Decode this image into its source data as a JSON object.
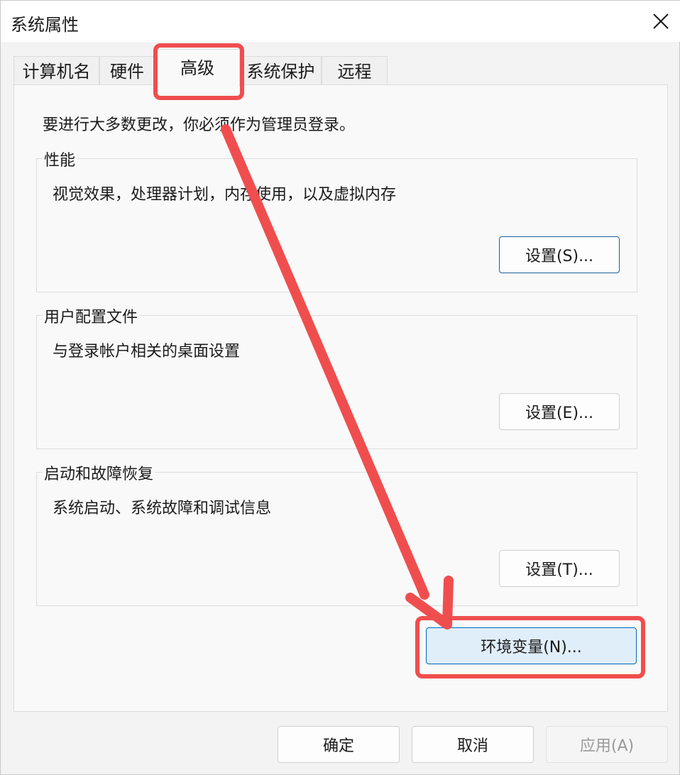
{
  "window": {
    "title": "系统属性"
  },
  "tabs": [
    {
      "label": "计算机名"
    },
    {
      "label": "硬件"
    },
    {
      "label": "高级"
    },
    {
      "label": "系统保护"
    },
    {
      "label": "远程"
    }
  ],
  "notice": "要进行大多数更改，你必须作为管理员登录。",
  "groups": [
    {
      "title": "性能",
      "description": "视觉效果，处理器计划，内存使用，以及虚拟内存",
      "button": "设置(S)..."
    },
    {
      "title": "用户配置文件",
      "description": "与登录帐户相关的桌面设置",
      "button": "设置(E)..."
    },
    {
      "title": "启动和故障恢复",
      "description": "系统启动、系统故障和调试信息",
      "button": "设置(T)..."
    }
  ],
  "env_button": "环境变量(N)...",
  "footer": {
    "ok": "确定",
    "cancel": "取消",
    "apply": "应用(A)"
  },
  "annotation": {
    "color": "#f04e4e"
  },
  "accent_color": "#0067c0"
}
